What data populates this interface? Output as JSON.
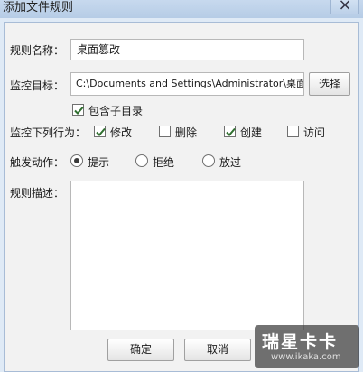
{
  "window": {
    "title": "添加文件规则",
    "close_icon": "×"
  },
  "form": {
    "rule_name_label": "规则名称：",
    "rule_name_value": "桌面篡改",
    "monitor_target_label": "监控目标：",
    "monitor_target_value": "C:\\Documents and Settings\\Administrator\\桌面",
    "choose_button": "选择",
    "include_subdirs_label": "包含子目录",
    "include_subdirs_checked": true,
    "monitor_actions_label": "监控下列行为：",
    "actions": [
      {
        "label": "修改",
        "checked": true
      },
      {
        "label": "删除",
        "checked": false
      },
      {
        "label": "创建",
        "checked": true
      },
      {
        "label": "访问",
        "checked": false
      }
    ],
    "trigger_label": "触发动作：",
    "trigger_options": [
      {
        "label": "提示",
        "selected": true
      },
      {
        "label": "拒绝",
        "selected": false
      },
      {
        "label": "放过",
        "selected": false
      }
    ],
    "description_label": "规则描述：",
    "description_value": ""
  },
  "buttons": {
    "ok": "确定",
    "cancel": "取消"
  },
  "watermark": {
    "main": "瑞星卡卡",
    "sub": "www.ikaka.com"
  }
}
